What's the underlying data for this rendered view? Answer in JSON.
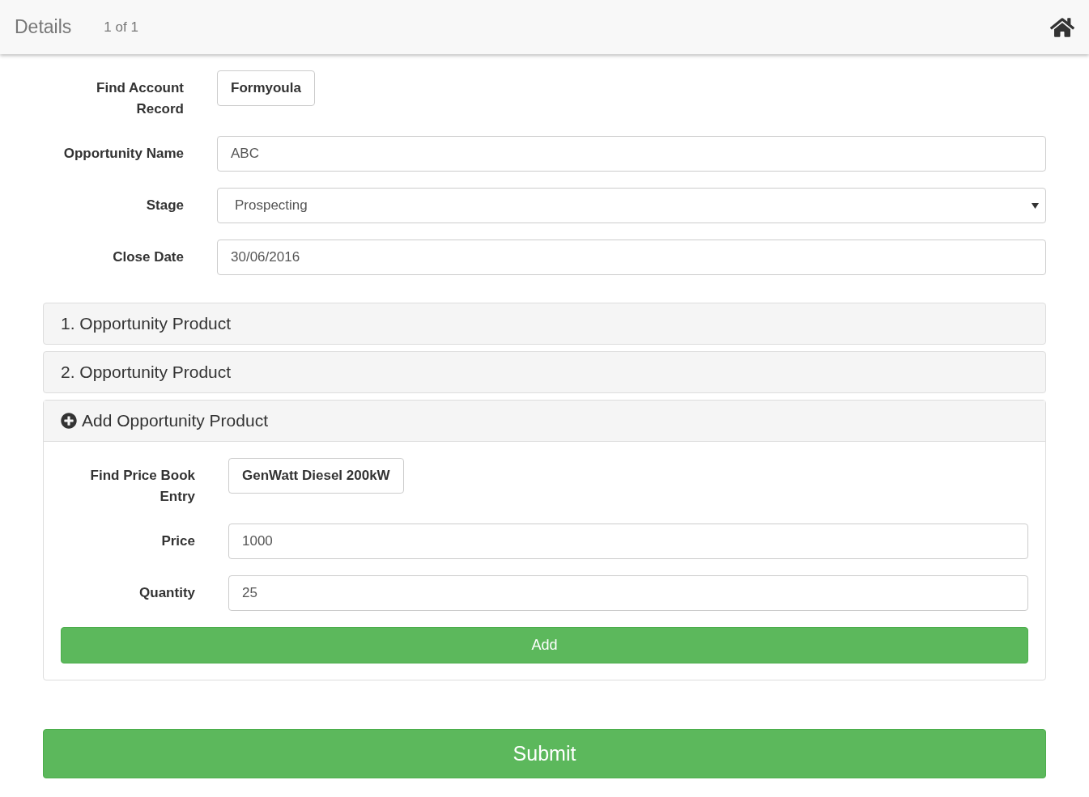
{
  "header": {
    "title": "Details",
    "page_count": "1 of 1"
  },
  "form": {
    "fields": [
      {
        "kind": "lookup",
        "label": "Find Account Record",
        "value": "Formyoula"
      },
      {
        "kind": "text",
        "label": "Opportunity Name",
        "value": "ABC"
      },
      {
        "kind": "select",
        "label": "Stage",
        "value": "Prospecting"
      },
      {
        "kind": "text",
        "label": "Close Date",
        "value": "30/06/2016"
      }
    ]
  },
  "products": [
    {
      "title": "1. Opportunity Product",
      "expanded": false
    },
    {
      "title": "2. Opportunity Product",
      "expanded": false
    }
  ],
  "add_product": {
    "title": "Add Opportunity Product",
    "expanded": true,
    "fields": [
      {
        "kind": "lookup",
        "label": "Find Price Book Entry",
        "value": "GenWatt Diesel 200kW"
      },
      {
        "kind": "text",
        "label": "Price",
        "value": "1000"
      },
      {
        "kind": "text",
        "label": "Quantity",
        "value": "25"
      }
    ],
    "button": "Add"
  },
  "submit": "Submit"
}
